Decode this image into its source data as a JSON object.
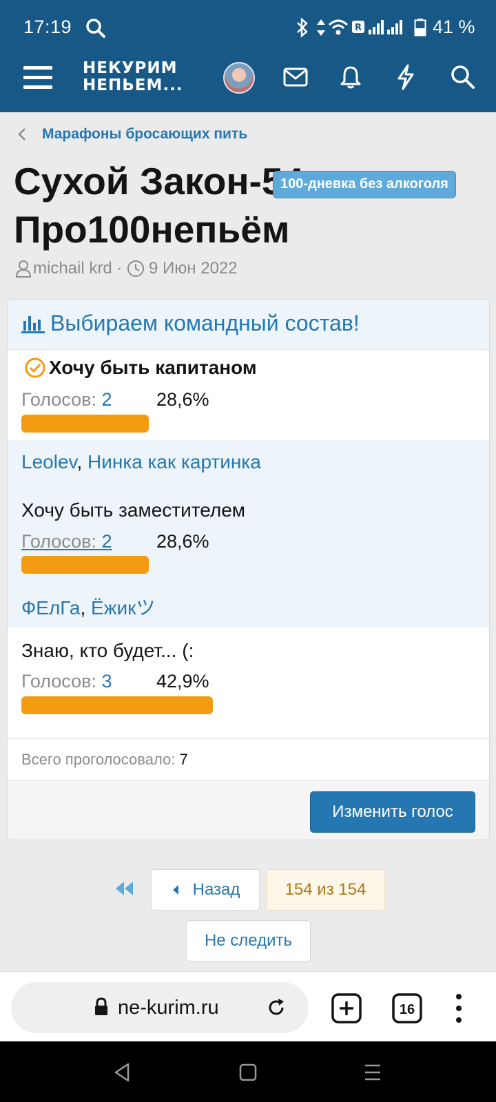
{
  "status_bar": {
    "time": "17:19",
    "battery_text": "41 %"
  },
  "header": {
    "logo_line1": "НЕКУРИМ",
    "logo_line2": "НЕПЬЕМ..."
  },
  "breadcrumb": {
    "label": "Марафоны бросающих пить"
  },
  "thread": {
    "title": "Сухой Закон-54: Про100непьём",
    "badge": "100-дневка без алкоголя",
    "author": "michail krd",
    "separator": " · ",
    "date": "9 Июн 2022"
  },
  "poll": {
    "title": "Выбираем командный состав!",
    "votes_prefix": "Голосов: ",
    "responses": [
      {
        "label": "Хочу быть капитаном",
        "votes": "2",
        "percent": "28,6%",
        "share": 0.286,
        "selected": true,
        "voters": [
          "Leolev",
          "Нинка как картинка"
        ]
      },
      {
        "label": "Хочу быть заместителем",
        "votes": "2",
        "percent": "28,6%",
        "share": 0.286,
        "selected": false,
        "voters": [
          "ФЕлГа",
          "Ёжикツ"
        ]
      },
      {
        "label": "Знаю, кто будет... (:",
        "votes": "3",
        "percent": "42,9%",
        "share": 0.429,
        "selected": false,
        "voters": []
      }
    ],
    "voter_separator": ", ",
    "total_label": "Всего проголосовало: ",
    "total": "7",
    "change_vote_label": "Изменить голос"
  },
  "pagination": {
    "back_label": "Назад",
    "page_info": "154 из 154",
    "unwatch_label": "Не следить"
  },
  "browser": {
    "url": "ne-kurim.ru",
    "tab_count": "16"
  },
  "colors": {
    "header_bg": "#185886",
    "link": "#2577b1",
    "bar": "#f39c12",
    "badge": "#5eaadb"
  }
}
